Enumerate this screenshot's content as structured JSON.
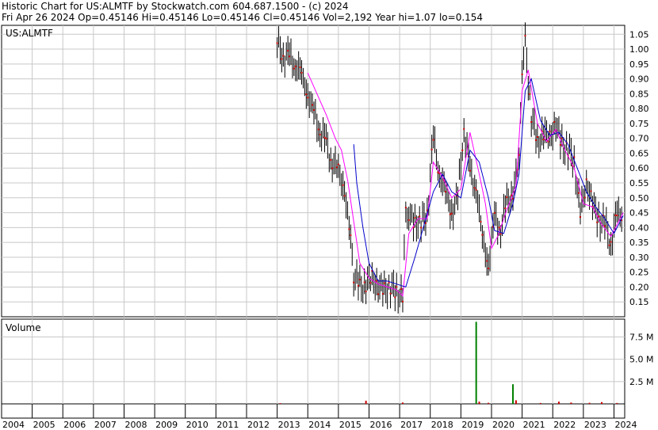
{
  "header": {
    "line1": "Historic Chart for US:ALMTF by Stockwatch.com 604.687.1500 - (c) 2024",
    "line2": "Fri Apr 26 2024   Op=0.45146   Hi=0.45146   Lo=0.45146   Cl=0.45146   Vol=2,192   Year hi=1.07   lo=0.154"
  },
  "chart_data": [
    {
      "type": "line",
      "title": "US:ALMTF",
      "x_range": [
        2004.0,
        2024.35
      ],
      "ylim": [
        0.1,
        1.08
      ],
      "y_ticks": [
        "0.15",
        "0.20",
        "0.25",
        "0.30",
        "0.35",
        "0.40",
        "0.45",
        "0.50",
        "0.55",
        "0.60",
        "0.65",
        "0.70",
        "0.75",
        "0.80",
        "0.85",
        "0.90",
        "0.95",
        "1.00",
        "1.05"
      ],
      "grid": true,
      "colors": {
        "price": "#000000",
        "close_dot": "#cc0000",
        "ma_short": "#ff00ff",
        "ma_long": "#0000cc",
        "grid": "#c8c8c8"
      },
      "series": [
        {
          "key": "price",
          "x": [
            2013.0,
            2013.2,
            2013.4,
            2013.6,
            2013.8,
            2014.0,
            2014.2,
            2014.4,
            2014.6,
            2014.8,
            2015.0,
            2015.2,
            2015.4,
            2015.5,
            2015.7,
            2015.9,
            2016.1,
            2016.3,
            2016.5,
            2016.7,
            2016.9,
            2017.1,
            2017.2,
            2017.3,
            2017.5,
            2017.7,
            2017.9,
            2018.1,
            2018.3,
            2018.5,
            2018.7,
            2018.9,
            2019.1,
            2019.3,
            2019.5,
            2019.7,
            2019.9,
            2020.1,
            2020.3,
            2020.5,
            2020.7,
            2020.9,
            2021.0,
            2021.1,
            2021.3,
            2021.5,
            2021.7,
            2021.9,
            2022.1,
            2022.3,
            2022.5,
            2022.7,
            2022.9,
            2023.1,
            2023.3,
            2023.5,
            2023.7,
            2023.9,
            2024.1,
            2024.3
          ],
          "values": [
            1.02,
            0.98,
            0.97,
            0.95,
            0.91,
            0.85,
            0.78,
            0.73,
            0.68,
            0.62,
            0.59,
            0.53,
            0.35,
            0.24,
            0.2,
            0.21,
            0.23,
            0.2,
            0.19,
            0.2,
            0.18,
            0.17,
            0.45,
            0.44,
            0.42,
            0.41,
            0.45,
            0.7,
            0.58,
            0.52,
            0.45,
            0.5,
            0.74,
            0.58,
            0.54,
            0.36,
            0.28,
            0.43,
            0.4,
            0.48,
            0.52,
            0.62,
            0.94,
            1.02,
            0.78,
            0.68,
            0.72,
            0.7,
            0.75,
            0.68,
            0.66,
            0.62,
            0.45,
            0.55,
            0.48,
            0.43,
            0.41,
            0.35,
            0.44,
            0.45
          ]
        },
        {
          "key": "ma_short",
          "x": [
            2014.0,
            2014.3,
            2014.6,
            2014.9,
            2015.1,
            2015.3,
            2015.5,
            2015.7,
            2016.0,
            2016.3,
            2016.6,
            2016.9,
            2017.1,
            2017.3,
            2017.6,
            2017.9,
            2018.1,
            2018.4,
            2018.7,
            2019.0,
            2019.3,
            2019.6,
            2019.8,
            2020.0,
            2020.2,
            2020.5,
            2020.8,
            2021.0,
            2021.2,
            2021.5,
            2021.8,
            2022.1,
            2022.4,
            2022.7,
            2023.0,
            2023.3,
            2023.6,
            2023.9,
            2024.3
          ],
          "values": [
            0.92,
            0.85,
            0.78,
            0.7,
            0.66,
            0.56,
            0.42,
            0.28,
            0.23,
            0.21,
            0.2,
            0.19,
            0.17,
            0.38,
            0.43,
            0.43,
            0.62,
            0.57,
            0.5,
            0.53,
            0.72,
            0.58,
            0.48,
            0.33,
            0.37,
            0.46,
            0.54,
            0.86,
            0.93,
            0.75,
            0.69,
            0.73,
            0.66,
            0.6,
            0.48,
            0.47,
            0.41,
            0.37,
            0.45
          ]
        },
        {
          "key": "ma_long",
          "x": [
            2015.5,
            2015.6,
            2015.8,
            2016.0,
            2016.3,
            2016.6,
            2016.9,
            2017.2,
            2017.5,
            2017.8,
            2018.1,
            2018.4,
            2018.7,
            2019.0,
            2019.3,
            2019.6,
            2019.9,
            2020.1,
            2020.4,
            2020.7,
            2020.9,
            2021.1,
            2021.3,
            2021.6,
            2021.9,
            2022.2,
            2022.5,
            2022.8,
            2023.1,
            2023.4,
            2023.7,
            2024.0,
            2024.3
          ],
          "values": [
            0.68,
            0.55,
            0.4,
            0.28,
            0.22,
            0.22,
            0.21,
            0.2,
            0.3,
            0.41,
            0.52,
            0.58,
            0.52,
            0.5,
            0.66,
            0.62,
            0.5,
            0.39,
            0.38,
            0.48,
            0.58,
            0.86,
            0.9,
            0.76,
            0.71,
            0.72,
            0.68,
            0.6,
            0.52,
            0.47,
            0.43,
            0.38,
            0.44
          ]
        }
      ]
    },
    {
      "type": "bar",
      "title": "Volume",
      "ylim": [
        0,
        9500000
      ],
      "y_ticks": [
        "2.5 M",
        "5.0 M",
        "7.5 M"
      ],
      "y_tick_values": [
        2500000,
        5000000,
        7500000
      ],
      "colors": {
        "bar": "#008000",
        "small_bar": "#cc0000"
      },
      "x": [
        2013.1,
        2015.9,
        2017.1,
        2019.5,
        2019.6,
        2019.9,
        2020.7,
        2020.8,
        2021.6,
        2022.2,
        2022.6,
        2023.2,
        2023.6,
        2024.1
      ],
      "values": [
        80000,
        350000,
        150000,
        9200000,
        250000,
        120000,
        2200000,
        400000,
        100000,
        250000,
        150000,
        120000,
        200000,
        100000
      ]
    }
  ],
  "x_axis": {
    "labels": [
      "2004",
      "2005",
      "2006",
      "2007",
      "2008",
      "2009",
      "2010",
      "2011",
      "2012",
      "2013",
      "2014",
      "2015",
      "2016",
      "2017",
      "2018",
      "2019",
      "2020",
      "2021",
      "2022",
      "2023",
      "2024"
    ]
  }
}
